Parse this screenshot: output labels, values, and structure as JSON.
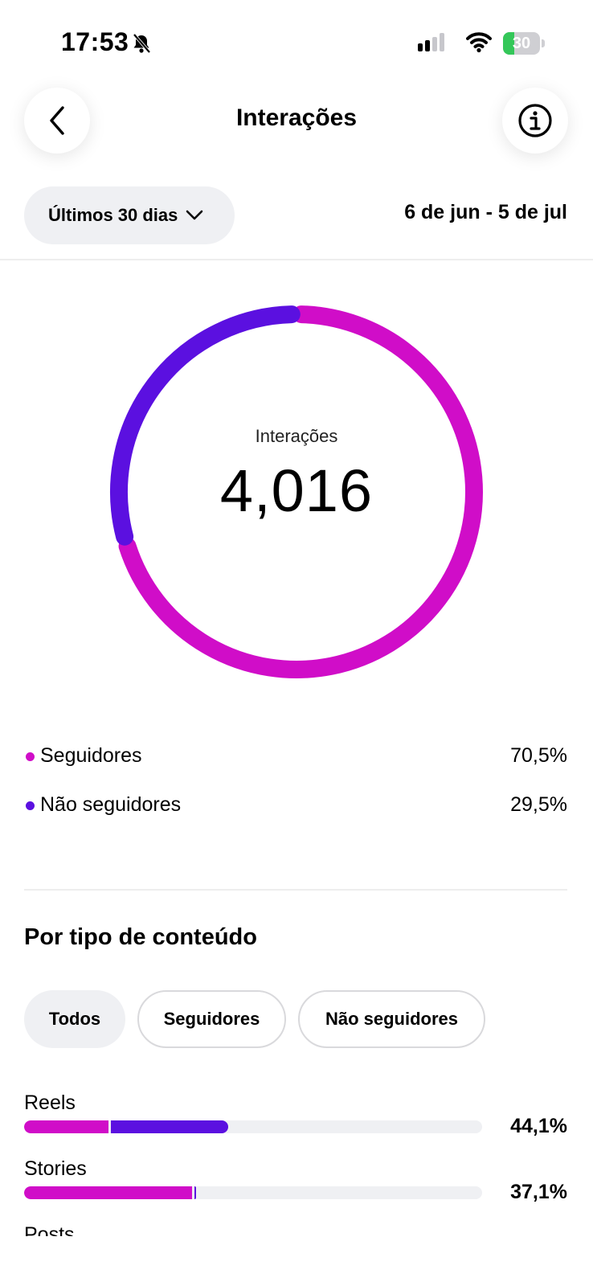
{
  "status_bar": {
    "time": "17:53",
    "battery": "30",
    "battery_level": 0.3
  },
  "header": {
    "title": "Interações"
  },
  "filters": {
    "range_label": "Últimos 30 dias",
    "date_range": "6 de jun - 5 de jul"
  },
  "donut": {
    "label": "Interações",
    "total": "4,016",
    "segments": [
      {
        "name": "Seguidores",
        "percent": 70.5,
        "color": "#d00dc8"
      },
      {
        "name": "Não seguidores",
        "percent": 29.5,
        "color": "#5b10e0"
      }
    ]
  },
  "legend": [
    {
      "label": "Seguidores",
      "value": "70,5%",
      "color": "#d00dc8"
    },
    {
      "label": "Não seguidores",
      "value": "29,5%",
      "color": "#5b10e0"
    }
  ],
  "content_type": {
    "title": "Por tipo de conteúdo",
    "chips": [
      {
        "label": "Todos",
        "active": true
      },
      {
        "label": "Seguidores",
        "active": false
      },
      {
        "label": "Não seguidores",
        "active": false
      }
    ],
    "rows": [
      {
        "label": "Reels",
        "value": "44,1%",
        "followers": 18.5,
        "non_followers": 25.6
      },
      {
        "label": "Stories",
        "value": "37,1%",
        "followers": 36.6,
        "non_followers": 0.5
      },
      {
        "label": "Posts",
        "value": ""
      }
    ]
  },
  "colors": {
    "followers": "#d00dc8",
    "non_followers": "#5b10e0"
  }
}
